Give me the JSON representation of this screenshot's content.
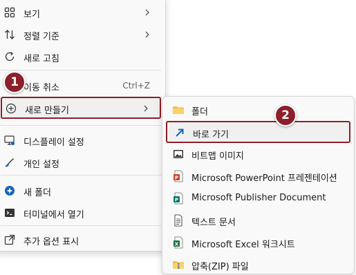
{
  "main_menu": {
    "view": {
      "label": "보기"
    },
    "sort": {
      "label": "정렬 기준"
    },
    "refresh": {
      "label": "새로 고침"
    },
    "undo": {
      "label": "이동 취소",
      "shortcut": "Ctrl+Z"
    },
    "new": {
      "label": "새로 만들기"
    },
    "display": {
      "label": "디스플레이 설정"
    },
    "personalize": {
      "label": "개인 설정"
    },
    "new_folder": {
      "label": "새 폴더"
    },
    "terminal": {
      "label": "터미널에서 열기"
    },
    "more": {
      "label": "추가 옵션 표시"
    }
  },
  "sub_menu": {
    "folder": {
      "label": "폴더"
    },
    "shortcut": {
      "label": "바로 가기"
    },
    "bitmap": {
      "label": "비트맵 이미지"
    },
    "powerpoint": {
      "label": "Microsoft PowerPoint 프레젠테이션"
    },
    "publisher": {
      "label": "Microsoft Publisher Document"
    },
    "text": {
      "label": "텍스트 문서"
    },
    "excel": {
      "label": "Microsoft Excel 워크시트"
    },
    "zip": {
      "label": "압축(ZIP) 파일"
    }
  },
  "badges": {
    "step1": "1",
    "step2": "2"
  },
  "colors": {
    "highlight": "#8c1f2b",
    "accent": "#1565c0"
  }
}
